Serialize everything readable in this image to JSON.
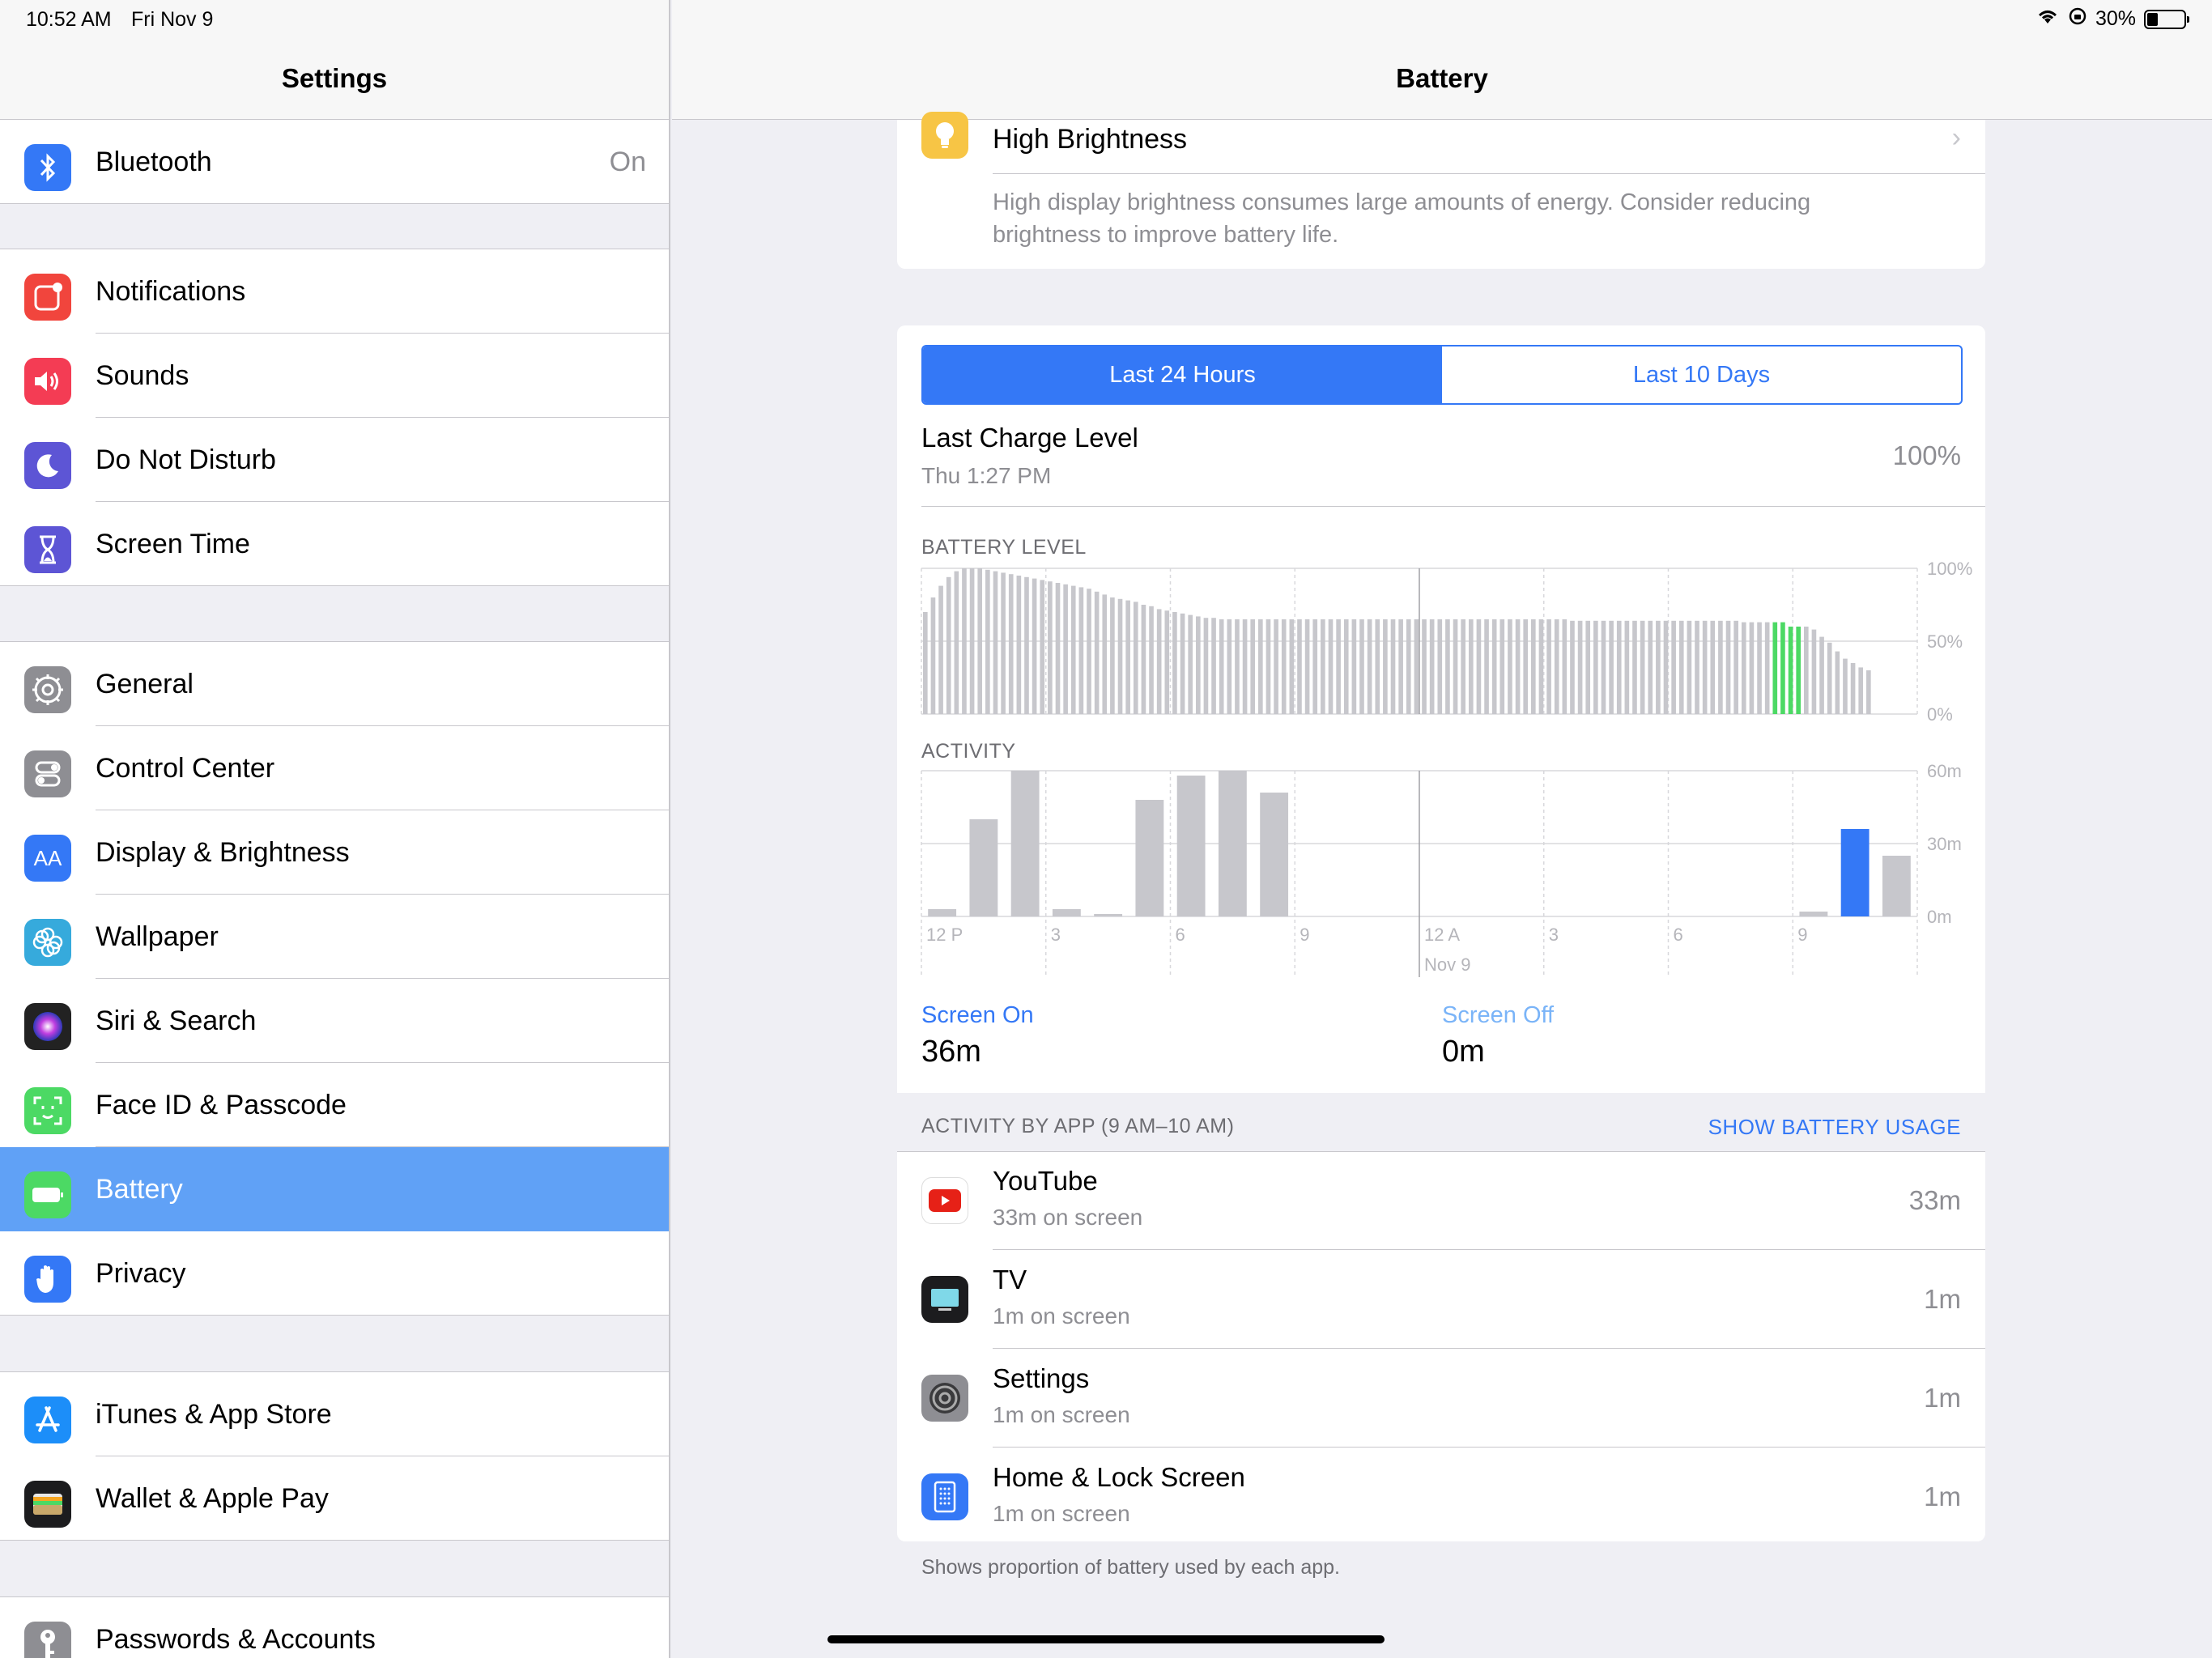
{
  "status": {
    "time": "10:52 AM",
    "date": "Fri Nov 9",
    "battery_percent": "30%",
    "battery_level": 0.3
  },
  "sidebar": {
    "title": "Settings",
    "items": [
      {
        "label": "Bluetooth",
        "value": "On",
        "icon": "bluetooth-icon",
        "color": "#3478f6"
      },
      {
        "label": "Notifications",
        "icon": "notifications-icon",
        "color": "#f1453d"
      },
      {
        "label": "Sounds",
        "icon": "speaker-icon",
        "color": "#f43c54"
      },
      {
        "label": "Do Not Disturb",
        "icon": "moon-icon",
        "color": "#5d55d5"
      },
      {
        "label": "Screen Time",
        "icon": "hourglass-icon",
        "color": "#5d55d5"
      },
      {
        "label": "General",
        "icon": "gear-icon",
        "color": "#8e8e93"
      },
      {
        "label": "Control Center",
        "icon": "toggles-icon",
        "color": "#8e8e93"
      },
      {
        "label": "Display & Brightness",
        "icon": "text-size-icon",
        "color": "#3478f6"
      },
      {
        "label": "Wallpaper",
        "icon": "flower-icon",
        "color": "#36aadc"
      },
      {
        "label": "Siri & Search",
        "icon": "siri-icon",
        "color": "#222"
      },
      {
        "label": "Face ID & Passcode",
        "icon": "face-id-icon",
        "color": "#4cd964"
      },
      {
        "label": "Battery",
        "icon": "battery-icon",
        "color": "#4cd964",
        "selected": true
      },
      {
        "label": "Privacy",
        "icon": "hand-icon",
        "color": "#3478f6"
      },
      {
        "label": "iTunes & App Store",
        "icon": "app-store-icon",
        "color": "#1c8ef9"
      },
      {
        "label": "Wallet & Apple Pay",
        "icon": "wallet-icon",
        "color": "#1c1c1e"
      },
      {
        "label": "Passwords & Accounts",
        "icon": "key-icon",
        "color": "#8e8e93"
      }
    ]
  },
  "detail": {
    "title": "Battery",
    "high_brightness": {
      "label": "High Brightness",
      "description": "High display brightness consumes large amounts of energy. Consider reducing brightness to improve battery life."
    },
    "segment": {
      "tab1": "Last 24 Hours",
      "tab2": "Last 10 Days",
      "selected": "Last 24 Hours"
    },
    "last_charge": {
      "title": "Last Charge Level",
      "time": "Thu 1:27 PM",
      "value": "100%"
    },
    "battery_level_label": "BATTERY LEVEL",
    "activity_label": "ACTIVITY",
    "screen_on": {
      "label": "Screen On",
      "value": "36m"
    },
    "screen_off": {
      "label": "Screen Off",
      "value": "0m"
    },
    "activity_by_app": "ACTIVITY BY APP (9 AM–10 AM)",
    "show_usage": "SHOW BATTERY USAGE",
    "apps": [
      {
        "name": "YouTube",
        "sub": "33m on screen",
        "value": "33m",
        "icon": "youtube-icon"
      },
      {
        "name": "TV",
        "sub": "1m on screen",
        "value": "1m",
        "icon": "tv-icon"
      },
      {
        "name": "Settings",
        "sub": "1m on screen",
        "value": "1m",
        "icon": "settings-icon"
      },
      {
        "name": "Home & Lock Screen",
        "sub": "1m on screen",
        "value": "1m",
        "icon": "home-screen-icon"
      }
    ],
    "footnote": "Shows proportion of battery used by each app.",
    "colors": {
      "accent": "#3478f6",
      "charging": "#4cd964",
      "bar": "#c7c7cc"
    }
  },
  "chart_data": [
    {
      "type": "bar",
      "title": "BATTERY LEVEL",
      "ylim": [
        0,
        100
      ],
      "yticks": [
        "100%",
        "50%",
        "0%"
      ],
      "x_tick_labels": [
        "12 P",
        "3",
        "6",
        "9",
        "12 A",
        "3",
        "6",
        "9"
      ],
      "x_sublabel": "Nov 9",
      "values": [
        70,
        80,
        88,
        94,
        98,
        100,
        100,
        100,
        99,
        98,
        97,
        96,
        95,
        94,
        93,
        92,
        91,
        90,
        89,
        88,
        87,
        86,
        84,
        82,
        80,
        79,
        78,
        77,
        75,
        74,
        72,
        71,
        70,
        69,
        68,
        67,
        66,
        66,
        65,
        65,
        65,
        65,
        65,
        65,
        65,
        65,
        65,
        65,
        65,
        65,
        65,
        65,
        65,
        65,
        65,
        65,
        65,
        65,
        65,
        65,
        65,
        65,
        65,
        65,
        65,
        65,
        65,
        65,
        65,
        65,
        65,
        65,
        65,
        65,
        65,
        65,
        65,
        65,
        65,
        65,
        65,
        65,
        65,
        64,
        64,
        64,
        64,
        64,
        64,
        64,
        64,
        64,
        64,
        64,
        64,
        64,
        64,
        64,
        64,
        64,
        64,
        64,
        64,
        64,
        64,
        63,
        63,
        63,
        63,
        63,
        63,
        60,
        60,
        60,
        58,
        53,
        49,
        43,
        38,
        35,
        32,
        30
      ],
      "charging_index_start": 109,
      "charging_index_end": 112
    },
    {
      "type": "bar",
      "title": "ACTIVITY",
      "ylim": [
        0,
        60
      ],
      "yticks": [
        "60m",
        "30m",
        "0m"
      ],
      "x_tick_labels": [
        "12 P",
        "3",
        "6",
        "9",
        "12 A",
        "3",
        "6",
        "9"
      ],
      "x_sublabel": "Nov 9",
      "values": [
        3,
        40,
        60,
        3,
        1,
        48,
        58,
        60,
        51,
        0,
        0,
        0,
        0,
        0,
        0,
        0,
        0,
        0,
        0,
        0,
        0,
        2,
        36,
        25
      ],
      "highlight_index": 22
    }
  ]
}
